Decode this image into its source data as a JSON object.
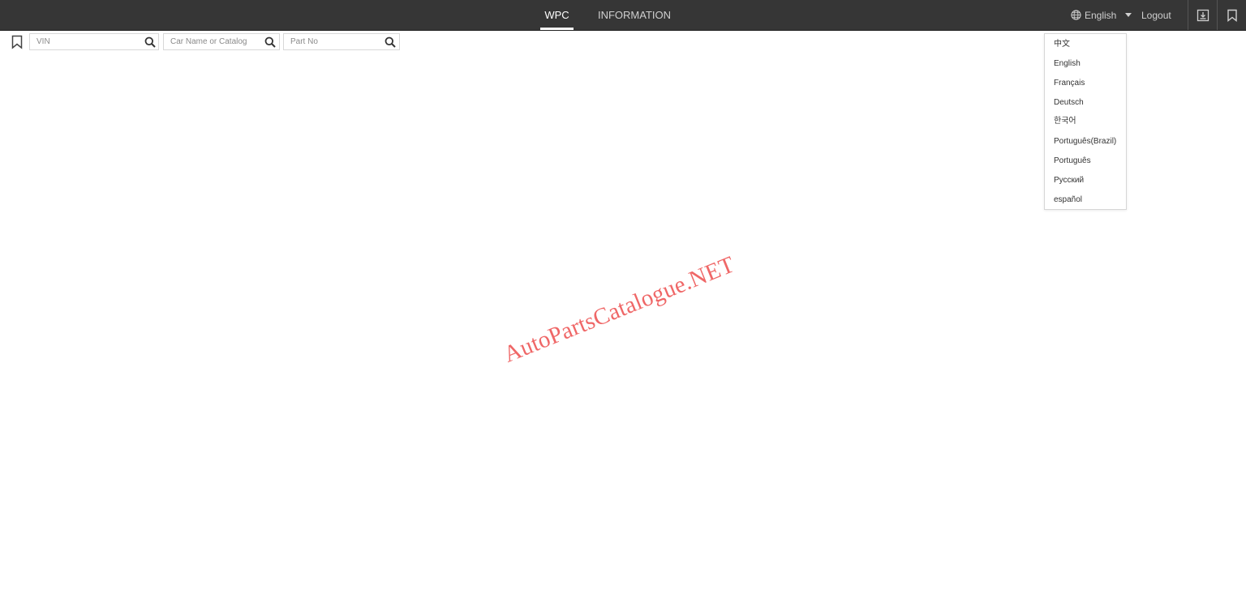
{
  "header": {
    "tabs": [
      {
        "label": "WPC",
        "active": true
      },
      {
        "label": "INFORMATION",
        "active": false
      }
    ],
    "language": {
      "icon": "globe-icon",
      "selected": "English"
    },
    "logout_label": "Logout",
    "icons": [
      "download-icon",
      "bookmark-icon"
    ]
  },
  "search": {
    "bookmark_icon": "bookmark-icon",
    "vin": {
      "placeholder": "VIN",
      "value": ""
    },
    "car_name": {
      "placeholder": "Car Name or Catalog",
      "value": ""
    },
    "part_no": {
      "placeholder": "Part No",
      "value": ""
    }
  },
  "language_menu": {
    "options": [
      "中文",
      "English",
      "Français",
      "Deutsch",
      "한국어",
      "Português(Brazil)",
      "Português",
      "Русский",
      "español"
    ]
  },
  "watermark": "AutoPartsCatalogue.NET",
  "colors": {
    "topbar": "#363636",
    "watermark": "#ef5f5f"
  }
}
